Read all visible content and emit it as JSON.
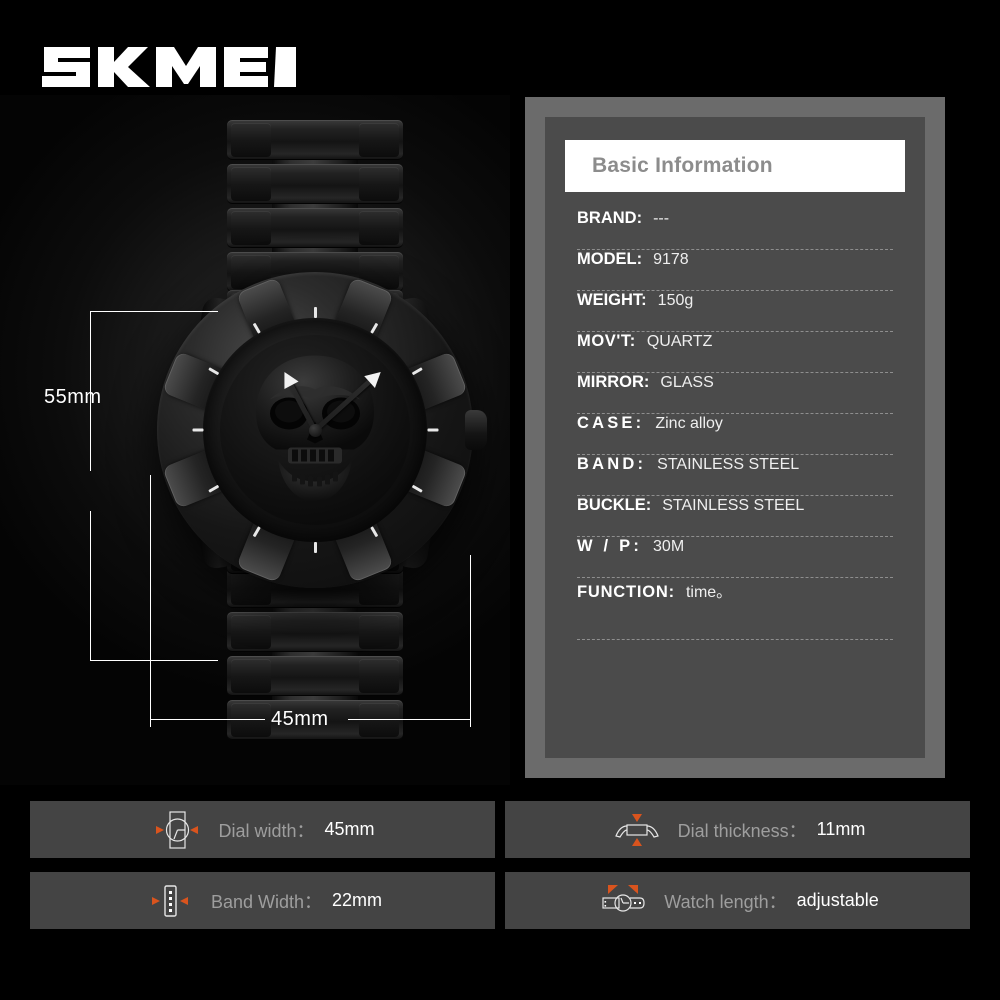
{
  "brand": {
    "logo_text": "SKMEI"
  },
  "product_image": {
    "alt": "black skull dial stainless steel watch",
    "dimension_height": "55mm",
    "dimension_width": "45mm"
  },
  "spec_panel": {
    "header": "Basic Information",
    "rows": [
      {
        "label": "BRAND:",
        "value": "---"
      },
      {
        "label": "MODEL:",
        "value": "9178"
      },
      {
        "label": "WEIGHT:",
        "value": "150g"
      },
      {
        "label": "MOV'T:",
        "value": "QUARTZ"
      },
      {
        "label": "MIRROR:",
        "value": "GLASS"
      },
      {
        "label": "CASE:",
        "value": "Zinc alloy"
      },
      {
        "label": "BAND:",
        "value": "STAINLESS STEEL"
      },
      {
        "label": "BUCKLE:",
        "value": "STAINLESS STEEL"
      },
      {
        "label": "W / P:",
        "value": "30M"
      },
      {
        "label": "FUNCTION:",
        "value": "time。"
      }
    ]
  },
  "footer_tiles": [
    {
      "icon": "dial-width-icon",
      "label": "Dial width：",
      "value": "45mm"
    },
    {
      "icon": "dial-thickness-icon",
      "label": "Dial thickness：",
      "value": "11mm"
    },
    {
      "icon": "band-width-icon",
      "label": "Band Width：",
      "value": "22mm"
    },
    {
      "icon": "watch-length-icon",
      "label": "Watch length：",
      "value": "adjustable"
    }
  ],
  "colors": {
    "background": "#000000",
    "panel_outer": "#6b6b6b",
    "panel_inner": "#4b4b4b",
    "header_bg": "#ffffff",
    "header_text": "#8c8c8c",
    "tile_bg": "#444444",
    "tile_label": "#9e9e9e",
    "accent_orange": "#d9541e"
  }
}
